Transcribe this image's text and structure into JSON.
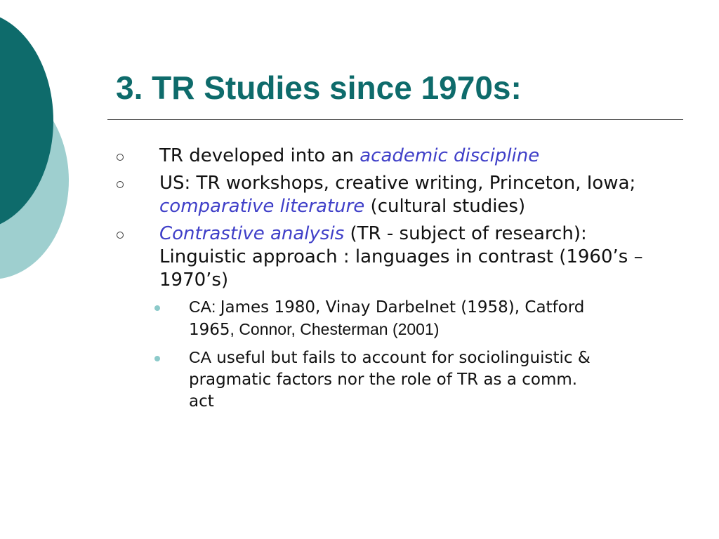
{
  "slide": {
    "title": "3. TR Studies since 1970s:",
    "bullets": [
      {
        "pre": "TR developed into an ",
        "em": "academic discipline"
      },
      {
        "pre": "US: TR workshops, creative writing, Princeton, Iowa; ",
        "em": "comparative literature",
        "post": " (cultural studies)"
      },
      {
        "em": "Contrastive analysis",
        "post": " (TR  - subject of research): Linguistic approach : languages in contrast (1960’s – 1970’s)"
      }
    ],
    "sub_bullets": [
      {
        "a": "CA",
        "b": ": ",
        "c": "James 1980, Vinay Darbelnet  (1958), Catford 1965",
        "d": ", Connor, Chesterman (2001)"
      },
      {
        "a": "CA",
        "b": " useful but fails to account for sociolinguistic & pragmatic factors nor the role of TR as a comm. act"
      }
    ]
  },
  "colors": {
    "title": "#0e6b6b",
    "circle_dark": "#0e6b6b",
    "circle_light": "#9ecfcf",
    "emphasis": "#3f3fc8",
    "sub_bullet": "#8ccaca"
  }
}
